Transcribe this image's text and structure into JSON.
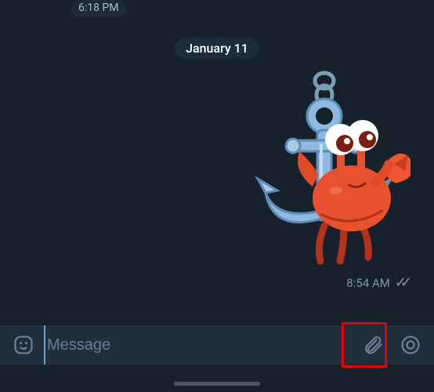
{
  "prev_time": "6:18 PM",
  "date_separator": "January 11",
  "sticker": {
    "time": "8:54 AM",
    "status": "read"
  },
  "composer": {
    "placeholder": "Message",
    "value": ""
  },
  "icons": {
    "emoji": "emoji-icon",
    "attach": "attachment-icon",
    "record": "voice-record-icon"
  }
}
